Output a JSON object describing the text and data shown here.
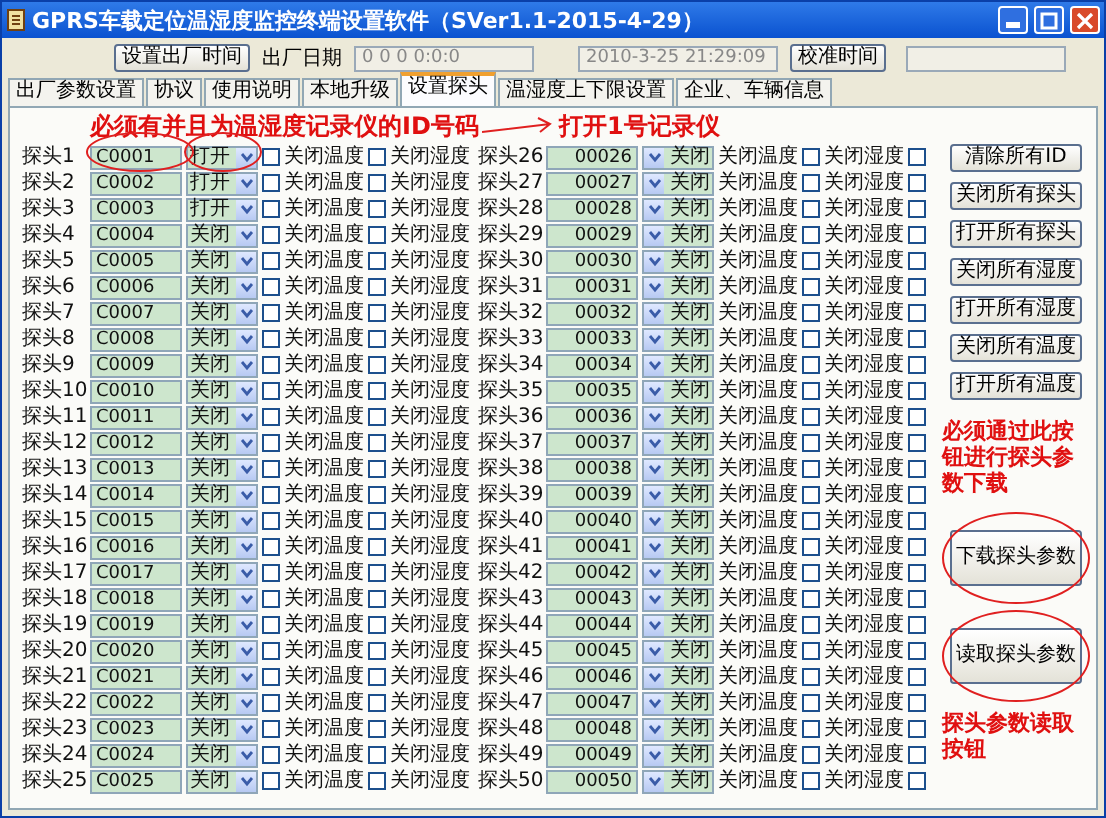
{
  "window": {
    "title": "GPRS车载定位温湿度监控终端设置软件（SVer1.1-2015-4-29）"
  },
  "toolbar": {
    "set_button": "设置出厂时间",
    "date_label": "出厂日期",
    "date_value": "0 0 0 0:0:0",
    "clock_value": "2010-3-25 21:29:09",
    "calibrate_button": "校准时间"
  },
  "tabs": [
    {
      "label": "出厂参数设置",
      "selected": false
    },
    {
      "label": "协议",
      "selected": false
    },
    {
      "label": "使用说明",
      "selected": false
    },
    {
      "label": "本地升级",
      "selected": false
    },
    {
      "label": "设置探头",
      "selected": true
    },
    {
      "label": "温湿度上下限设置",
      "selected": false
    },
    {
      "label": "企业、车辆信息",
      "selected": false
    }
  ],
  "annotations": {
    "id_note": "必须有并且为温湿度记录仪的ID号码",
    "open_note": "打开1号记录仪",
    "download_note": "必须通过此按钮进行探头参数下载",
    "read_note": "探头参数读取按钮"
  },
  "probes_left": [
    {
      "label": "探头1",
      "id": "C0001",
      "mode": "打开",
      "temp_off": {
        "label": "关闭温度",
        "checked": false
      },
      "humi_off": {
        "label": "关闭湿度",
        "checked": false
      }
    },
    {
      "label": "探头2",
      "id": "C0002",
      "mode": "打开",
      "temp_off": {
        "label": "关闭温度",
        "checked": false
      },
      "humi_off": {
        "label": "关闭湿度",
        "checked": false
      }
    },
    {
      "label": "探头3",
      "id": "C0003",
      "mode": "打开",
      "temp_off": {
        "label": "关闭温度",
        "checked": false
      },
      "humi_off": {
        "label": "关闭湿度",
        "checked": false
      }
    },
    {
      "label": "探头4",
      "id": "C0004",
      "mode": "关闭",
      "temp_off": {
        "label": "关闭温度",
        "checked": false
      },
      "humi_off": {
        "label": "关闭湿度",
        "checked": false
      }
    },
    {
      "label": "探头5",
      "id": "C0005",
      "mode": "关闭",
      "temp_off": {
        "label": "关闭温度",
        "checked": false
      },
      "humi_off": {
        "label": "关闭湿度",
        "checked": false
      }
    },
    {
      "label": "探头6",
      "id": "C0006",
      "mode": "关闭",
      "temp_off": {
        "label": "关闭温度",
        "checked": false
      },
      "humi_off": {
        "label": "关闭湿度",
        "checked": false
      }
    },
    {
      "label": "探头7",
      "id": "C0007",
      "mode": "关闭",
      "temp_off": {
        "label": "关闭温度",
        "checked": false
      },
      "humi_off": {
        "label": "关闭湿度",
        "checked": false
      }
    },
    {
      "label": "探头8",
      "id": "C0008",
      "mode": "关闭",
      "temp_off": {
        "label": "关闭温度",
        "checked": false
      },
      "humi_off": {
        "label": "关闭湿度",
        "checked": false
      }
    },
    {
      "label": "探头9",
      "id": "C0009",
      "mode": "关闭",
      "temp_off": {
        "label": "关闭温度",
        "checked": false
      },
      "humi_off": {
        "label": "关闭湿度",
        "checked": false
      }
    },
    {
      "label": "探头10",
      "id": "C0010",
      "mode": "关闭",
      "temp_off": {
        "label": "关闭温度",
        "checked": false
      },
      "humi_off": {
        "label": "关闭湿度",
        "checked": false
      }
    },
    {
      "label": "探头11",
      "id": "C0011",
      "mode": "关闭",
      "temp_off": {
        "label": "关闭温度",
        "checked": false
      },
      "humi_off": {
        "label": "关闭湿度",
        "checked": false
      }
    },
    {
      "label": "探头12",
      "id": "C0012",
      "mode": "关闭",
      "temp_off": {
        "label": "关闭温度",
        "checked": false
      },
      "humi_off": {
        "label": "关闭湿度",
        "checked": false
      }
    },
    {
      "label": "探头13",
      "id": "C0013",
      "mode": "关闭",
      "temp_off": {
        "label": "关闭温度",
        "checked": false
      },
      "humi_off": {
        "label": "关闭湿度",
        "checked": false
      }
    },
    {
      "label": "探头14",
      "id": "C0014",
      "mode": "关闭",
      "temp_off": {
        "label": "关闭温度",
        "checked": false
      },
      "humi_off": {
        "label": "关闭湿度",
        "checked": false
      }
    },
    {
      "label": "探头15",
      "id": "C0015",
      "mode": "关闭",
      "temp_off": {
        "label": "关闭温度",
        "checked": false
      },
      "humi_off": {
        "label": "关闭湿度",
        "checked": false
      }
    },
    {
      "label": "探头16",
      "id": "C0016",
      "mode": "关闭",
      "temp_off": {
        "label": "关闭温度",
        "checked": false
      },
      "humi_off": {
        "label": "关闭湿度",
        "checked": false
      }
    },
    {
      "label": "探头17",
      "id": "C0017",
      "mode": "关闭",
      "temp_off": {
        "label": "关闭温度",
        "checked": false
      },
      "humi_off": {
        "label": "关闭湿度",
        "checked": false
      }
    },
    {
      "label": "探头18",
      "id": "C0018",
      "mode": "关闭",
      "temp_off": {
        "label": "关闭温度",
        "checked": false
      },
      "humi_off": {
        "label": "关闭湿度",
        "checked": false
      }
    },
    {
      "label": "探头19",
      "id": "C0019",
      "mode": "关闭",
      "temp_off": {
        "label": "关闭温度",
        "checked": false
      },
      "humi_off": {
        "label": "关闭湿度",
        "checked": false
      }
    },
    {
      "label": "探头20",
      "id": "C0020",
      "mode": "关闭",
      "temp_off": {
        "label": "关闭温度",
        "checked": false
      },
      "humi_off": {
        "label": "关闭湿度",
        "checked": false
      }
    },
    {
      "label": "探头21",
      "id": "C0021",
      "mode": "关闭",
      "temp_off": {
        "label": "关闭温度",
        "checked": false
      },
      "humi_off": {
        "label": "关闭湿度",
        "checked": false
      }
    },
    {
      "label": "探头22",
      "id": "C0022",
      "mode": "关闭",
      "temp_off": {
        "label": "关闭温度",
        "checked": false
      },
      "humi_off": {
        "label": "关闭湿度",
        "checked": false
      }
    },
    {
      "label": "探头23",
      "id": "C0023",
      "mode": "关闭",
      "temp_off": {
        "label": "关闭温度",
        "checked": false
      },
      "humi_off": {
        "label": "关闭湿度",
        "checked": false
      }
    },
    {
      "label": "探头24",
      "id": "C0024",
      "mode": "关闭",
      "temp_off": {
        "label": "关闭温度",
        "checked": false
      },
      "humi_off": {
        "label": "关闭湿度",
        "checked": false
      }
    },
    {
      "label": "探头25",
      "id": "C0025",
      "mode": "关闭",
      "temp_off": {
        "label": "关闭温度",
        "checked": false
      },
      "humi_off": {
        "label": "关闭湿度",
        "checked": false
      }
    }
  ],
  "probes_right": [
    {
      "label": "探头26",
      "id": "00026",
      "mode": "关闭",
      "temp_off": {
        "label": "关闭温度",
        "checked": false
      },
      "humi_off": {
        "label": "关闭湿度",
        "checked": false
      }
    },
    {
      "label": "探头27",
      "id": "00027",
      "mode": "关闭",
      "temp_off": {
        "label": "关闭温度",
        "checked": false
      },
      "humi_off": {
        "label": "关闭湿度",
        "checked": false
      }
    },
    {
      "label": "探头28",
      "id": "00028",
      "mode": "关闭",
      "temp_off": {
        "label": "关闭温度",
        "checked": false
      },
      "humi_off": {
        "label": "关闭湿度",
        "checked": false
      }
    },
    {
      "label": "探头29",
      "id": "00029",
      "mode": "关闭",
      "temp_off": {
        "label": "关闭温度",
        "checked": false
      },
      "humi_off": {
        "label": "关闭湿度",
        "checked": false
      }
    },
    {
      "label": "探头30",
      "id": "00030",
      "mode": "关闭",
      "temp_off": {
        "label": "关闭温度",
        "checked": false
      },
      "humi_off": {
        "label": "关闭湿度",
        "checked": false
      }
    },
    {
      "label": "探头31",
      "id": "00031",
      "mode": "关闭",
      "temp_off": {
        "label": "关闭温度",
        "checked": false
      },
      "humi_off": {
        "label": "关闭湿度",
        "checked": false
      }
    },
    {
      "label": "探头32",
      "id": "00032",
      "mode": "关闭",
      "temp_off": {
        "label": "关闭温度",
        "checked": false
      },
      "humi_off": {
        "label": "关闭湿度",
        "checked": false
      }
    },
    {
      "label": "探头33",
      "id": "00033",
      "mode": "关闭",
      "temp_off": {
        "label": "关闭温度",
        "checked": false
      },
      "humi_off": {
        "label": "关闭湿度",
        "checked": false
      }
    },
    {
      "label": "探头34",
      "id": "00034",
      "mode": "关闭",
      "temp_off": {
        "label": "关闭温度",
        "checked": false
      },
      "humi_off": {
        "label": "关闭湿度",
        "checked": false
      }
    },
    {
      "label": "探头35",
      "id": "00035",
      "mode": "关闭",
      "temp_off": {
        "label": "关闭温度",
        "checked": false
      },
      "humi_off": {
        "label": "关闭湿度",
        "checked": false
      }
    },
    {
      "label": "探头36",
      "id": "00036",
      "mode": "关闭",
      "temp_off": {
        "label": "关闭温度",
        "checked": false
      },
      "humi_off": {
        "label": "关闭湿度",
        "checked": false
      }
    },
    {
      "label": "探头37",
      "id": "00037",
      "mode": "关闭",
      "temp_off": {
        "label": "关闭温度",
        "checked": false
      },
      "humi_off": {
        "label": "关闭湿度",
        "checked": false
      }
    },
    {
      "label": "探头38",
      "id": "00038",
      "mode": "关闭",
      "temp_off": {
        "label": "关闭温度",
        "checked": false
      },
      "humi_off": {
        "label": "关闭湿度",
        "checked": false
      }
    },
    {
      "label": "探头39",
      "id": "00039",
      "mode": "关闭",
      "temp_off": {
        "label": "关闭温度",
        "checked": false
      },
      "humi_off": {
        "label": "关闭湿度",
        "checked": false
      }
    },
    {
      "label": "探头40",
      "id": "00040",
      "mode": "关闭",
      "temp_off": {
        "label": "关闭温度",
        "checked": false
      },
      "humi_off": {
        "label": "关闭湿度",
        "checked": false
      }
    },
    {
      "label": "探头41",
      "id": "00041",
      "mode": "关闭",
      "temp_off": {
        "label": "关闭温度",
        "checked": false
      },
      "humi_off": {
        "label": "关闭湿度",
        "checked": false
      }
    },
    {
      "label": "探头42",
      "id": "00042",
      "mode": "关闭",
      "temp_off": {
        "label": "关闭温度",
        "checked": false
      },
      "humi_off": {
        "label": "关闭湿度",
        "checked": false
      }
    },
    {
      "label": "探头43",
      "id": "00043",
      "mode": "关闭",
      "temp_off": {
        "label": "关闭温度",
        "checked": false
      },
      "humi_off": {
        "label": "关闭湿度",
        "checked": false
      }
    },
    {
      "label": "探头44",
      "id": "00044",
      "mode": "关闭",
      "temp_off": {
        "label": "关闭温度",
        "checked": false
      },
      "humi_off": {
        "label": "关闭湿度",
        "checked": false
      }
    },
    {
      "label": "探头45",
      "id": "00045",
      "mode": "关闭",
      "temp_off": {
        "label": "关闭温度",
        "checked": false
      },
      "humi_off": {
        "label": "关闭湿度",
        "checked": false
      }
    },
    {
      "label": "探头46",
      "id": "00046",
      "mode": "关闭",
      "temp_off": {
        "label": "关闭温度",
        "checked": false
      },
      "humi_off": {
        "label": "关闭湿度",
        "checked": false
      }
    },
    {
      "label": "探头47",
      "id": "00047",
      "mode": "关闭",
      "temp_off": {
        "label": "关闭温度",
        "checked": false
      },
      "humi_off": {
        "label": "关闭湿度",
        "checked": false
      }
    },
    {
      "label": "探头48",
      "id": "00048",
      "mode": "关闭",
      "temp_off": {
        "label": "关闭温度",
        "checked": false
      },
      "humi_off": {
        "label": "关闭湿度",
        "checked": false
      }
    },
    {
      "label": "探头49",
      "id": "00049",
      "mode": "关闭",
      "temp_off": {
        "label": "关闭温度",
        "checked": false
      },
      "humi_off": {
        "label": "关闭湿度",
        "checked": false
      }
    },
    {
      "label": "探头50",
      "id": "00050",
      "mode": "关闭",
      "temp_off": {
        "label": "关闭温度",
        "checked": false
      },
      "humi_off": {
        "label": "关闭湿度",
        "checked": false
      }
    }
  ],
  "buttons": [
    "清除所有ID",
    "关闭所有探头",
    "打开所有探头",
    "关闭所有湿度",
    "打开所有湿度",
    "关闭所有温度",
    "打开所有温度"
  ],
  "download_button": "下载探头参数",
  "read_button": "读取探头参数"
}
